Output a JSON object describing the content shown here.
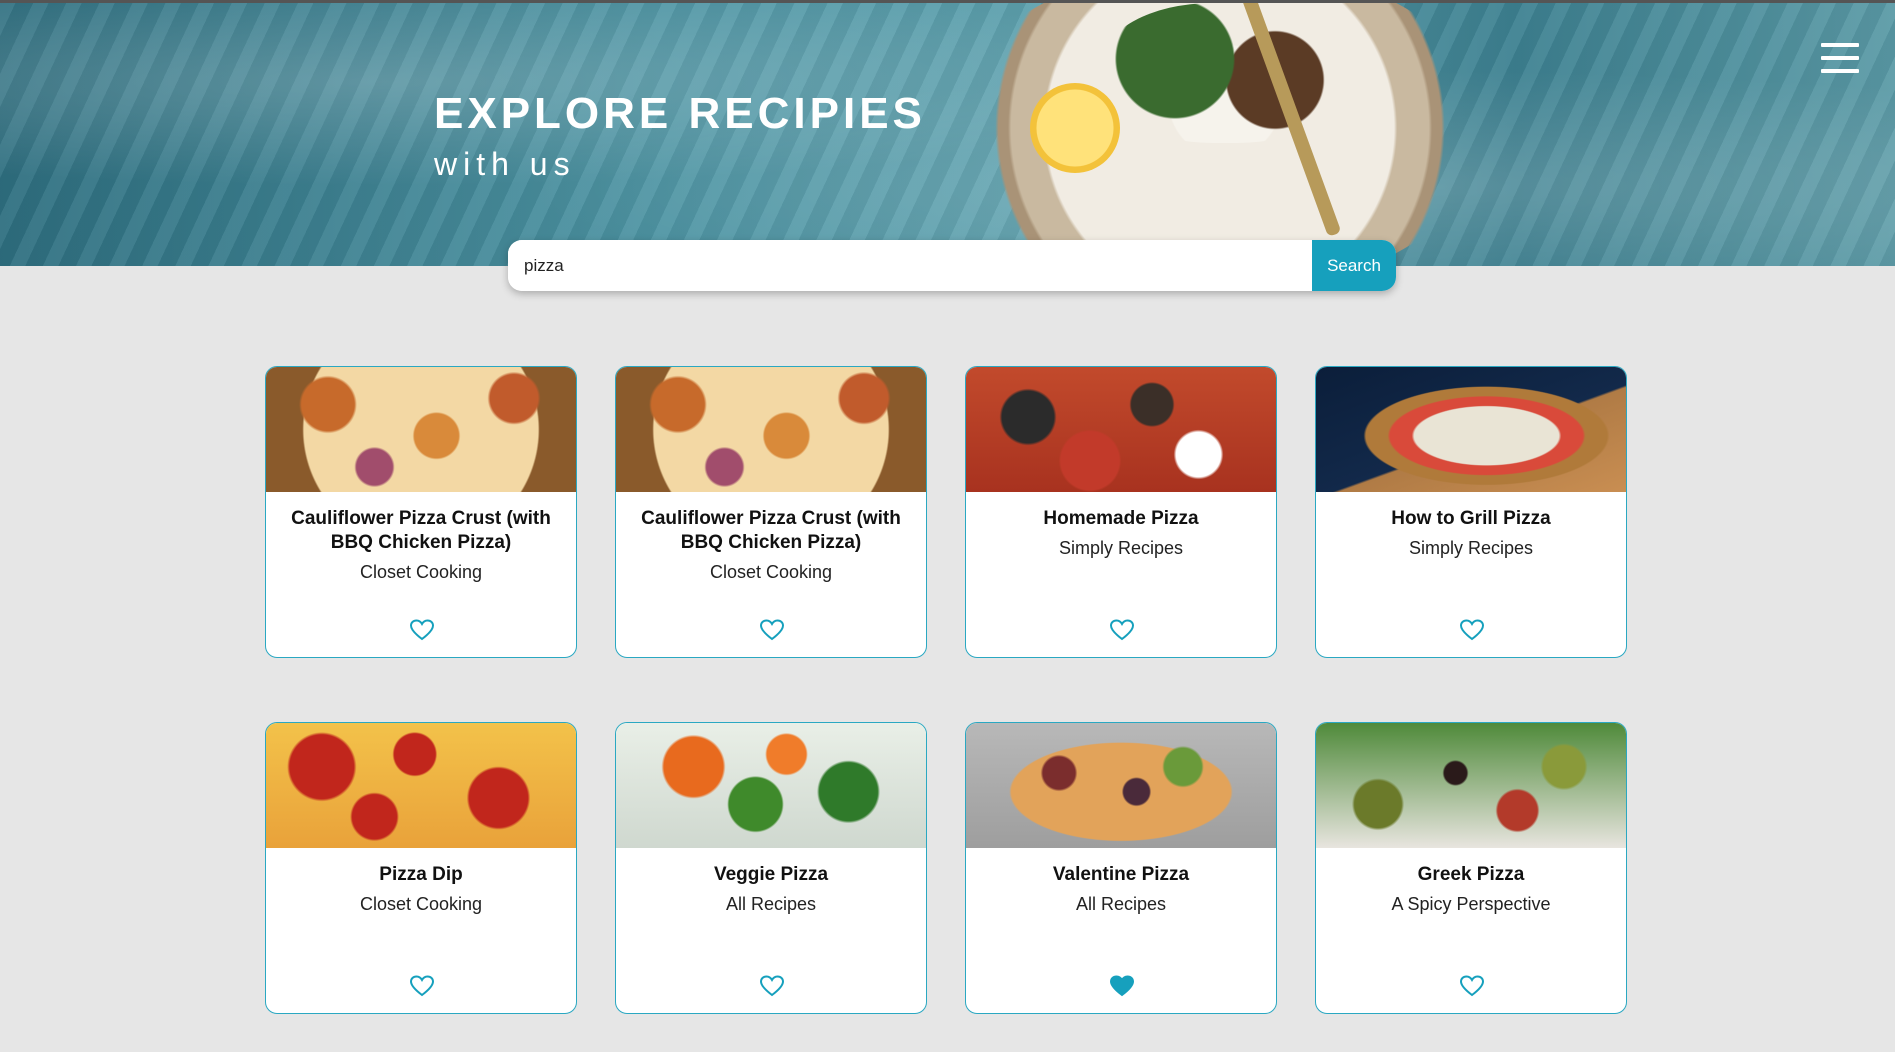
{
  "hero": {
    "title": "EXPLORE RECIPIES",
    "subtitle": "with us",
    "menu_icon": "menu-icon"
  },
  "search": {
    "value": "pizza",
    "placeholder": "",
    "button_label": "Search"
  },
  "colors": {
    "accent": "#16a0bd",
    "card_border": "#2aa8c2",
    "background": "#e6e6e6"
  },
  "recipes": [
    {
      "title": "Cauliflower Pizza Crust (with BBQ Chicken Pizza)",
      "source": "Closet Cooking",
      "favorited": false
    },
    {
      "title": "Cauliflower Pizza Crust (with BBQ Chicken Pizza)",
      "source": "Closet Cooking",
      "favorited": false
    },
    {
      "title": "Homemade Pizza",
      "source": "Simply Recipes",
      "favorited": false
    },
    {
      "title": "How to Grill Pizza",
      "source": "Simply Recipes",
      "favorited": false
    },
    {
      "title": "Pizza Dip",
      "source": "Closet Cooking",
      "favorited": false
    },
    {
      "title": "Veggie Pizza",
      "source": "All Recipes",
      "favorited": false
    },
    {
      "title": "Valentine Pizza",
      "source": "All Recipes",
      "favorited": true
    },
    {
      "title": "Greek Pizza",
      "source": "A Spicy Perspective",
      "favorited": false
    }
  ]
}
